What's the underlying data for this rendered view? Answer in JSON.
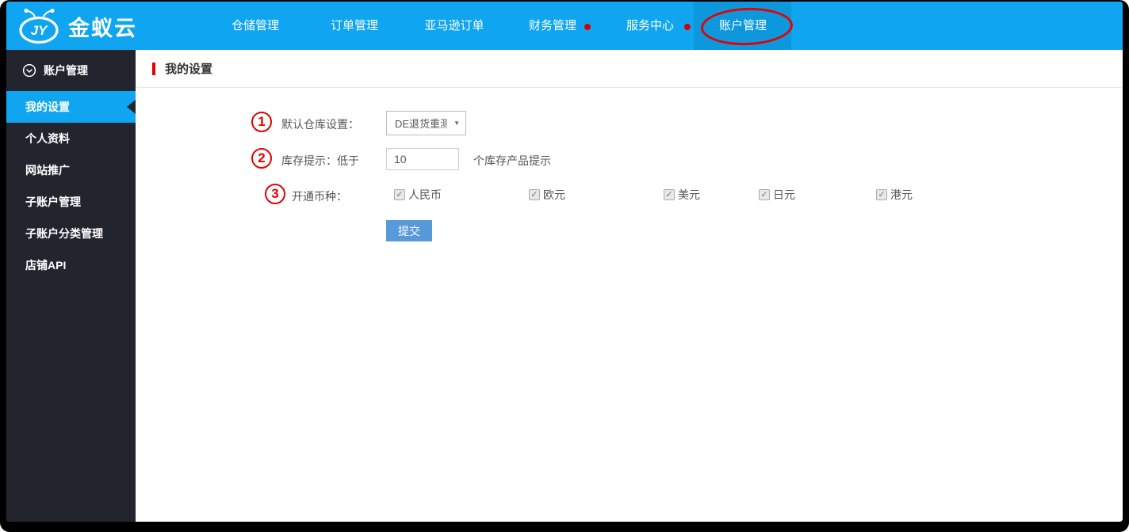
{
  "brand": {
    "name": "金蚁云"
  },
  "nav": {
    "items": [
      {
        "label": "仓储管理",
        "has_dot": false,
        "active": false
      },
      {
        "label": "订单管理",
        "has_dot": false,
        "active": false
      },
      {
        "label": "亚马逊订单",
        "has_dot": false,
        "active": false
      },
      {
        "label": "财务管理",
        "has_dot": true,
        "active": false
      },
      {
        "label": "服务中心",
        "has_dot": true,
        "active": false
      },
      {
        "label": "账户管理",
        "has_dot": false,
        "active": true,
        "annotated": true
      }
    ]
  },
  "sidebar": {
    "header_label": "账户管理",
    "items": [
      {
        "label": "我的设置",
        "active": true
      },
      {
        "label": "个人资料",
        "active": false
      },
      {
        "label": "网站推广",
        "active": false
      },
      {
        "label": "子账户管理",
        "active": false
      },
      {
        "label": "子账户分类管理",
        "active": false
      },
      {
        "label": "店铺API",
        "active": false
      }
    ]
  },
  "page": {
    "title": "我的设置"
  },
  "form": {
    "rows": [
      {
        "annotation": "1",
        "label": "默认仓库设置：",
        "select_value": "DE退货重测"
      },
      {
        "annotation": "2",
        "label": "库存提示：低于",
        "input_value": "10",
        "suffix": "个库存产品提示"
      },
      {
        "annotation": "3",
        "label": "开通币种：",
        "options": [
          "人民币",
          "欧元",
          "美元",
          "日元",
          "港元"
        ],
        "all_checked": true
      }
    ],
    "check_glyph": "✓",
    "select_arrow_glyph": "▼",
    "submit_label": "提交"
  },
  "colors": {
    "header_blue": "#0fa5f0",
    "active_tab_blue": "#0d97dd",
    "sidebar_dark": "#23252e",
    "annotation_red": "#e60000",
    "submit_blue": "#5799d9"
  }
}
